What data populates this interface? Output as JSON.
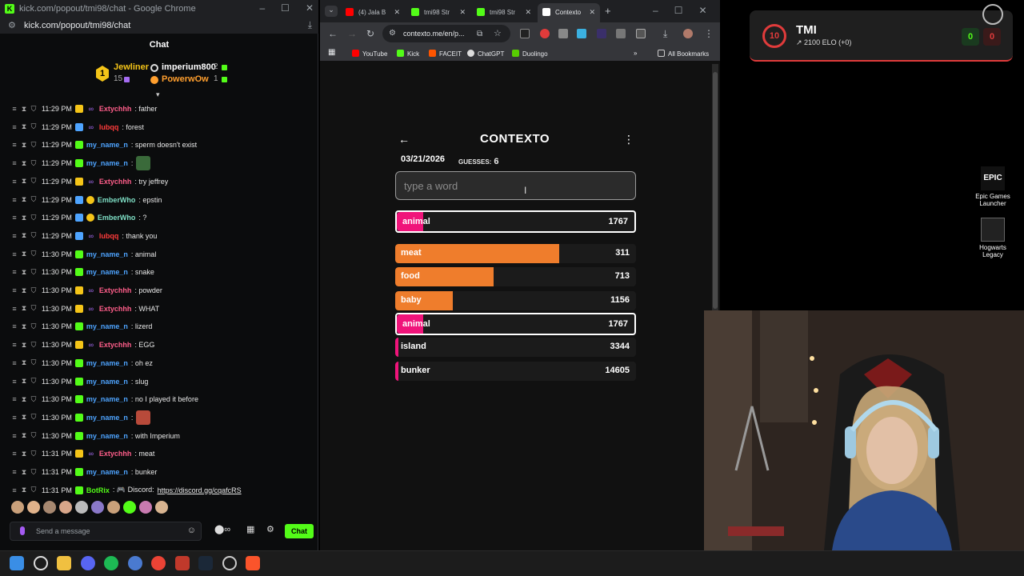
{
  "chat_window": {
    "title": "kick.com/popout/tmi98/chat - Google Chrome",
    "url": "kick.com/popout/tmi98/chat",
    "header": "Chat",
    "gifters": [
      {
        "name": "Jewliner",
        "count": "15",
        "rank": "1"
      },
      {
        "name": "imperium800",
        "count": "2"
      },
      {
        "name": "PowerwOw",
        "count": "1"
      }
    ],
    "messages": [
      {
        "time": "11:29 PM",
        "user": "Extychhh",
        "text": ": father",
        "color": "#ff5e8a"
      },
      {
        "time": "11:29 PM",
        "user": "lubqq",
        "text": ": forest",
        "color": "#ff3b3b"
      },
      {
        "time": "11:29 PM",
        "user": "my_name_n",
        "text": ": sperm doesn't exist",
        "color": "#4ea4ff"
      },
      {
        "time": "11:29 PM",
        "user": "my_name_n",
        "text": ":",
        "color": "#4ea4ff"
      },
      {
        "time": "11:29 PM",
        "user": "Extychhh",
        "text": ": try jeffrey",
        "color": "#ff5e8a"
      },
      {
        "time": "11:29 PM",
        "user": "EmberWho",
        "text": ": epstin",
        "color": "#7fe0c6"
      },
      {
        "time": "11:29 PM",
        "user": "EmberWho",
        "text": ": ?",
        "color": "#7fe0c6"
      },
      {
        "time": "11:29 PM",
        "user": "lubqq",
        "text": ": thank you",
        "color": "#ff3b3b"
      },
      {
        "time": "11:30 PM",
        "user": "my_name_n",
        "text": ": animal",
        "color": "#4ea4ff"
      },
      {
        "time": "11:30 PM",
        "user": "my_name_n",
        "text": ": snake",
        "color": "#4ea4ff"
      },
      {
        "time": "11:30 PM",
        "user": "Extychhh",
        "text": ": powder",
        "color": "#ff5e8a"
      },
      {
        "time": "11:30 PM",
        "user": "Extychhh",
        "text": ": WHAT",
        "color": "#ff5e8a"
      },
      {
        "time": "11:30 PM",
        "user": "my_name_n",
        "text": ": lizerd",
        "color": "#4ea4ff"
      },
      {
        "time": "11:30 PM",
        "user": "Extychhh",
        "text": ": EGG",
        "color": "#ff5e8a"
      },
      {
        "time": "11:30 PM",
        "user": "my_name_n",
        "text": ": oh ez",
        "color": "#4ea4ff"
      },
      {
        "time": "11:30 PM",
        "user": "my_name_n",
        "text": ": slug",
        "color": "#4ea4ff"
      },
      {
        "time": "11:30 PM",
        "user": "my_name_n",
        "text": ": no I played it before",
        "color": "#4ea4ff"
      },
      {
        "time": "11:30 PM",
        "user": "my_name_n",
        "text": ":",
        "color": "#4ea4ff"
      },
      {
        "time": "11:30 PM",
        "user": "my_name_n",
        "text": ": with Imperium",
        "color": "#4ea4ff"
      },
      {
        "time": "11:31 PM",
        "user": "Extychhh",
        "text": ": meat",
        "color": "#ff5e8a"
      },
      {
        "time": "11:31 PM",
        "user": "my_name_n",
        "text": ": bunker",
        "color": "#4ea4ff"
      },
      {
        "time": "11:31 PM",
        "user": "BotRix",
        "text": ": 🎮 Discord: ",
        "link": "https://discord.gg/cqafcRS",
        "color": "#53fc18"
      }
    ],
    "input_placeholder": "Send a message",
    "send_label": "Chat"
  },
  "browser": {
    "tabs": [
      {
        "label": "(4) Jala B",
        "icon_color": "#ff0000"
      },
      {
        "label": "tmi98 Str",
        "icon_color": "#53fc18"
      },
      {
        "label": "tmi98 Str",
        "icon_color": "#53fc18"
      },
      {
        "label": "Contexto",
        "icon_color": "#ffffff"
      }
    ],
    "url": "contexto.me/en/p...",
    "bookmarks": [
      "YouTube",
      "Kick",
      "FACEIT",
      "ChatGPT",
      "Duolingo"
    ],
    "all_bookmarks": "All Bookmarks"
  },
  "contexto": {
    "title": "CONTEXTO",
    "date": "03/21/2026",
    "guesses_label": "GUESSES:",
    "guesses": "6",
    "placeholder": "type a word",
    "last_guess": {
      "word": "animal",
      "rank": "1767",
      "fill": 0.11,
      "color": "#f0147a"
    },
    "guesses_list": [
      {
        "word": "meat",
        "rank": "311",
        "fill": 0.68,
        "color": "#ef7d2c",
        "highlight": false
      },
      {
        "word": "food",
        "rank": "713",
        "fill": 0.41,
        "color": "#ef7d2c",
        "highlight": false
      },
      {
        "word": "baby",
        "rank": "1156",
        "fill": 0.24,
        "color": "#ef7d2c",
        "highlight": false
      },
      {
        "word": "animal",
        "rank": "1767",
        "fill": 0.11,
        "color": "#f0147a",
        "highlight": true
      },
      {
        "word": "island",
        "rank": "3344",
        "fill": 0.01,
        "color": "#f0147a",
        "highlight": false
      },
      {
        "word": "bunker",
        "rank": "14605",
        "fill": 0.01,
        "color": "#f0147a",
        "highlight": false
      }
    ]
  },
  "faceit": {
    "level": "10",
    "name": "TMI",
    "elo": "2100 ELO (+0)",
    "wins": "0",
    "losses": "0"
  },
  "desktop": {
    "icons": [
      {
        "label": "Epic Games Launcher"
      },
      {
        "label": "Hogwarts Legacy"
      }
    ]
  }
}
